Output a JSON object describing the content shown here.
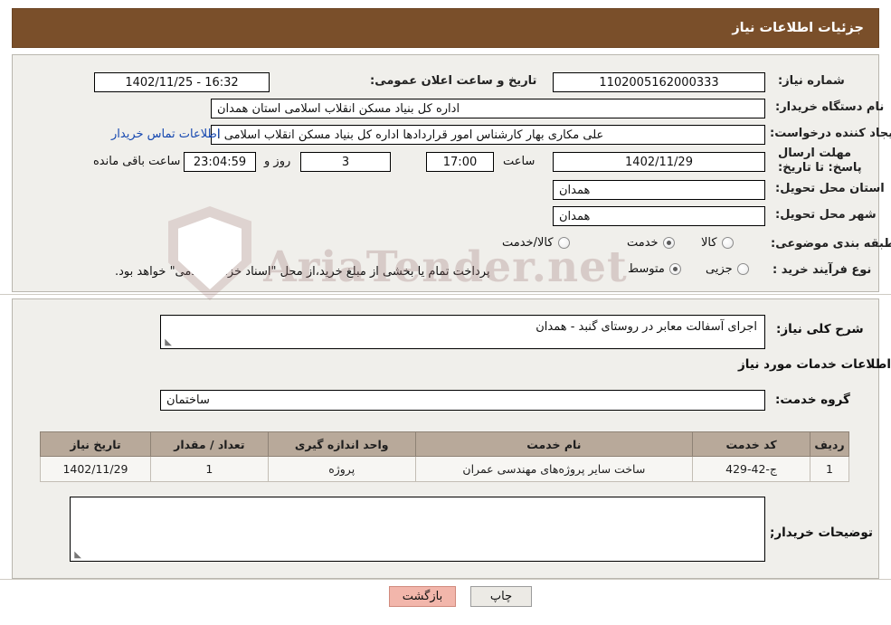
{
  "header": {
    "title": "جزئیات اطلاعات نیاز"
  },
  "fields": {
    "need_number_label": "شماره نیاز:",
    "need_number_value": "1102005162000333",
    "announce_datetime_label": "تاریخ و ساعت اعلان عمومی:",
    "announce_datetime_value": "16:32 - 1402/11/25",
    "buyer_org_label": "نام دستگاه خریدار:",
    "buyer_org_value": "اداره کل بنیاد مسکن انقلاب اسلامی استان همدان",
    "requester_label": "ایجاد کننده درخواست:",
    "requester_value": "علی مکاری بهار کارشناس امور قراردادها اداره کل بنیاد مسکن انقلاب اسلامی ا",
    "requester_link": "اطلاعات تماس خریدار",
    "deadline_label": "مهلت ارسال پاسخ: تا تاریخ:",
    "deadline_date": "1402/11/29",
    "deadline_hour_label": "ساعت",
    "deadline_hour": "17:00",
    "days_value": "3",
    "days_label": "روز و",
    "countdown_value": "23:04:59",
    "remaining_label": "ساعت باقی مانده",
    "delivery_province_label": "استان محل تحویل:",
    "delivery_province_value": "همدان",
    "delivery_city_label": "شهر محل تحویل:",
    "delivery_city_value": "همدان",
    "category_label": "طبقه بندی موضوعی:",
    "category_options": [
      "کالا",
      "خدمت",
      "کالا/خدمت"
    ],
    "category_selected": "خدمت",
    "purchase_type_label": "نوع فرآیند خرید :",
    "purchase_type_options": [
      "جزیی",
      "متوسط"
    ],
    "purchase_type_selected": "متوسط",
    "purchase_note": "پرداخت تمام یا بخشی از مبلغ خرید،از محل \"اسناد خزانه اسلامی\" خواهد بود."
  },
  "summary": {
    "label": "شرح کلی نیاز:",
    "value": "اجرای آسفالت معابر در روستای گنبد - همدان"
  },
  "services_section": {
    "heading": "اطلاعات خدمات مورد نیاز",
    "group_label": "گروه خدمت:",
    "group_value": "ساختمان"
  },
  "table": {
    "headers": [
      "ردیف",
      "کد خدمت",
      "نام خدمت",
      "واحد اندازه گیری",
      "تعداد / مقدار",
      "تاریخ نیاز"
    ],
    "rows": [
      {
        "row": "1",
        "code": "ج-42-429",
        "name": "ساخت سایر پروژه‌های مهندسی عمران",
        "unit": "پروژه",
        "qty": "1",
        "date": "1402/11/29"
      }
    ]
  },
  "buyer_notes": {
    "label": "توضیحات خریدار;",
    "value": ""
  },
  "buttons": {
    "print": "چاپ",
    "back": "بازگشت"
  },
  "watermark": {
    "text": "AriaTender.net"
  },
  "colors": {
    "header_bg": "#7a4f2a",
    "panel_bg": "#f0efeb",
    "table_header_bg": "#b8a99a",
    "link": "#1648b0",
    "back_button_bg": "#f2b6ab"
  }
}
